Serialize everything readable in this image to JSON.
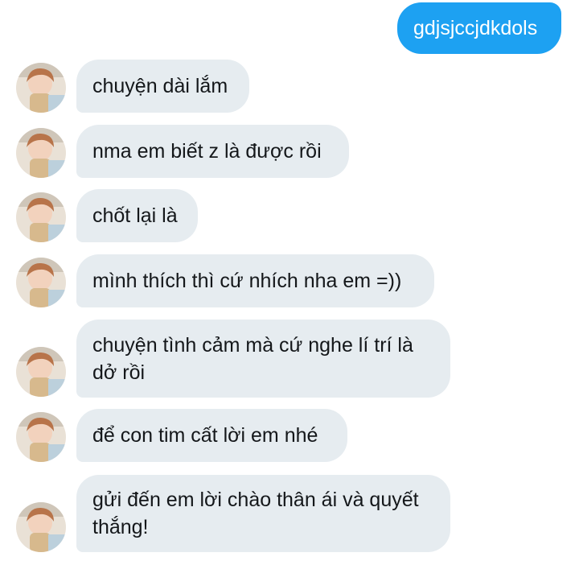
{
  "outgoing": {
    "text": "gdjsjccjdkdols"
  },
  "incoming": [
    {
      "text": "chuyện dài lắm"
    },
    {
      "text": "nma em biết z là được rồi"
    },
    {
      "text": "chốt lại là"
    },
    {
      "text": "mình thích thì cứ nhích nha em =))"
    },
    {
      "text": "chuyện tình cảm mà cứ nghe lí trí là dở rồi"
    },
    {
      "text": "để con tim cất lời em nhé"
    },
    {
      "text": "gửi đến em lời chào thân ái và quyết thắng!"
    }
  ],
  "colors": {
    "outgoing_bubble": "#1da1f2",
    "incoming_bubble": "#e6ecf0"
  }
}
